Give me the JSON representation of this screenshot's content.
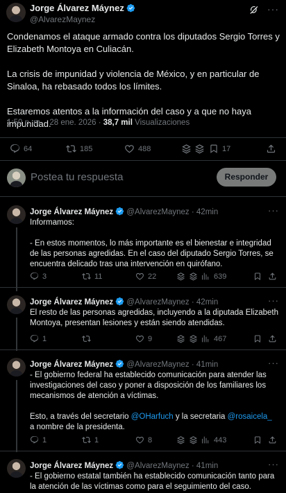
{
  "main_tweet": {
    "author_name": "Jorge Álvarez Máynez",
    "author_handle": "@AlvarezMaynez",
    "text": "Condenamos el ataque armado contra los diputados Sergio Torres y Elizabeth Montoya en Culiacán.\n\nLa crisis de impunidad y violencia de México, y en particular de Sinaloa, ha rebasado todos los límites.\n\nEstaremos atentos a la información del caso y a que no haya impunidad.",
    "timestamp": "1:50 p. m. · 28 ene. 2026 ·",
    "views_count": "38,7 mil",
    "views_label": "Visualizaciones",
    "replies": "64",
    "reposts": "185",
    "likes": "488",
    "bookmarks": "17"
  },
  "composer": {
    "placeholder": "Postea tu respuesta",
    "reply_button": "Responder"
  },
  "replies": [
    {
      "name": "Jorge Álvarez Máynez",
      "handle": "@AlvarezMaynez",
      "time": "· 42min",
      "text": "Informamos:\n\n- En estos momentos, lo más importante es el bienestar e integridad de las personas agredidas. En el caso del diputado Sergio Torres, se encuentra delicado tras una intervención en quirófano.",
      "replies": "3",
      "reposts": "11",
      "likes": "22",
      "views": "639"
    },
    {
      "name": "Jorge Álvarez Máynez",
      "handle": "@AlvarezMaynez",
      "time": "· 42min",
      "text": "El resto de las personas agredidas, incluyendo a la diputada Elizabeth Montoya, presentan lesiones y están siendo atendidas.",
      "replies": "1",
      "reposts": "",
      "likes": "9",
      "views": "467"
    },
    {
      "name": "Jorge Álvarez Máynez",
      "handle": "@AlvarezMaynez",
      "time": "· 41min",
      "text_before": "- El gobierno federal ha establecido comunicación para atender las investigaciones del caso y poner a disposición de los familiares los mecanismos de atención a víctimas.\n\nEsto, a través del secretario ",
      "mention1": "@OHarfuch",
      "text_middle": " y la secretaria ",
      "mention2": "@rosaicela_",
      "text_after": " a nombre de la presidenta.",
      "replies": "1",
      "reposts": "1",
      "likes": "8",
      "views": "443"
    },
    {
      "name": "Jorge Álvarez Máynez",
      "handle": "@AlvarezMaynez",
      "time": "· 41min",
      "text": "- El gobierno estatal también ha establecido comunicación tanto para la atención de las víctimas como para el seguimiento del caso."
    }
  ],
  "icons": {
    "verified_color": "#1d9bf0",
    "accent": "#1d9bf0",
    "muted": "#71767b"
  }
}
